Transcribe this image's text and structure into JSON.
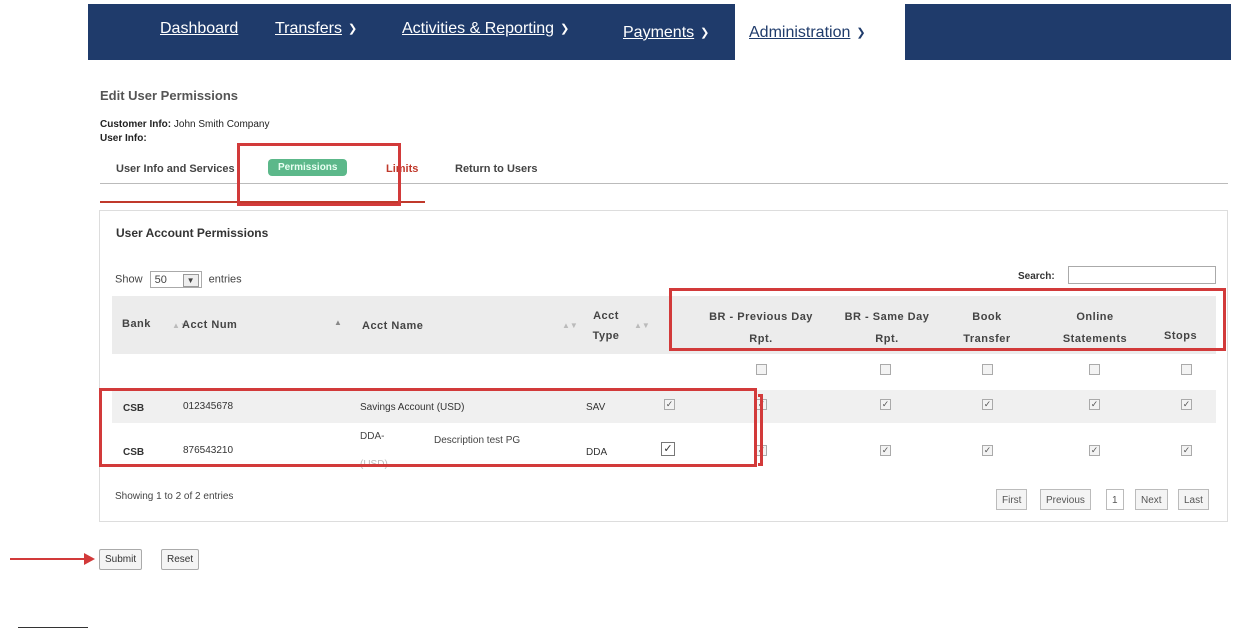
{
  "nav": {
    "items": [
      {
        "label": "Dashboard",
        "chevron": false
      },
      {
        "label": "Transfers",
        "chevron": true
      },
      {
        "label": "Activities & Reporting",
        "chevron": true
      },
      {
        "label": "Payments",
        "chevron": true
      }
    ],
    "active": {
      "label": "Administration",
      "chevron": true
    }
  },
  "page": {
    "title": "Edit User Permissions",
    "customer_info_label": "Customer Info:",
    "customer_info_value": "John Smith Company",
    "user_info_label": "User Info:"
  },
  "tabs": [
    {
      "label": "User Info and Services"
    },
    {
      "label": "Permissions",
      "active": true
    },
    {
      "label": "Limits"
    },
    {
      "label": "Return to Users"
    }
  ],
  "panel": {
    "title": "User Account Permissions",
    "show_label": "Show",
    "entries_value": "50",
    "entries_label": "entries",
    "search_label": "Search:",
    "search_value": ""
  },
  "table": {
    "columns": [
      "Bank",
      "Acct Num",
      "Acct Name",
      "Acct Type",
      "BR - Previous Day Rpt.",
      "BR - Same Day Rpt.",
      "Book Transfer",
      "Online Statements",
      "Stops"
    ],
    "rows": [
      {
        "bank": "CSB",
        "acct_num": "012345678",
        "acct_name": "Savings Account (USD)",
        "acct_type": "SAV",
        "select": true,
        "br_prev": true,
        "br_same": true,
        "book": true,
        "online": true,
        "stops": true
      },
      {
        "bank": "CSB",
        "acct_num": "876543210",
        "acct_name": "DDA- Description test PG (USD)",
        "acct_name_line1": "DDA-",
        "acct_name_line1b": "Description test PG",
        "acct_name_line2": "(USD)",
        "acct_type": "DDA",
        "select": true,
        "br_prev": true,
        "br_same": true,
        "book": true,
        "online": true,
        "stops": true
      }
    ]
  },
  "footer": {
    "info": "Showing 1 to 2 of 2 entries",
    "pager": [
      "First",
      "Previous",
      "1",
      "Next",
      "Last"
    ]
  },
  "actions": {
    "submit": "Submit",
    "reset": "Reset"
  },
  "colors": {
    "nav_bg": "#1f3b6b",
    "accent_red": "#d23a3a",
    "tab_active": "#5cb88a"
  }
}
